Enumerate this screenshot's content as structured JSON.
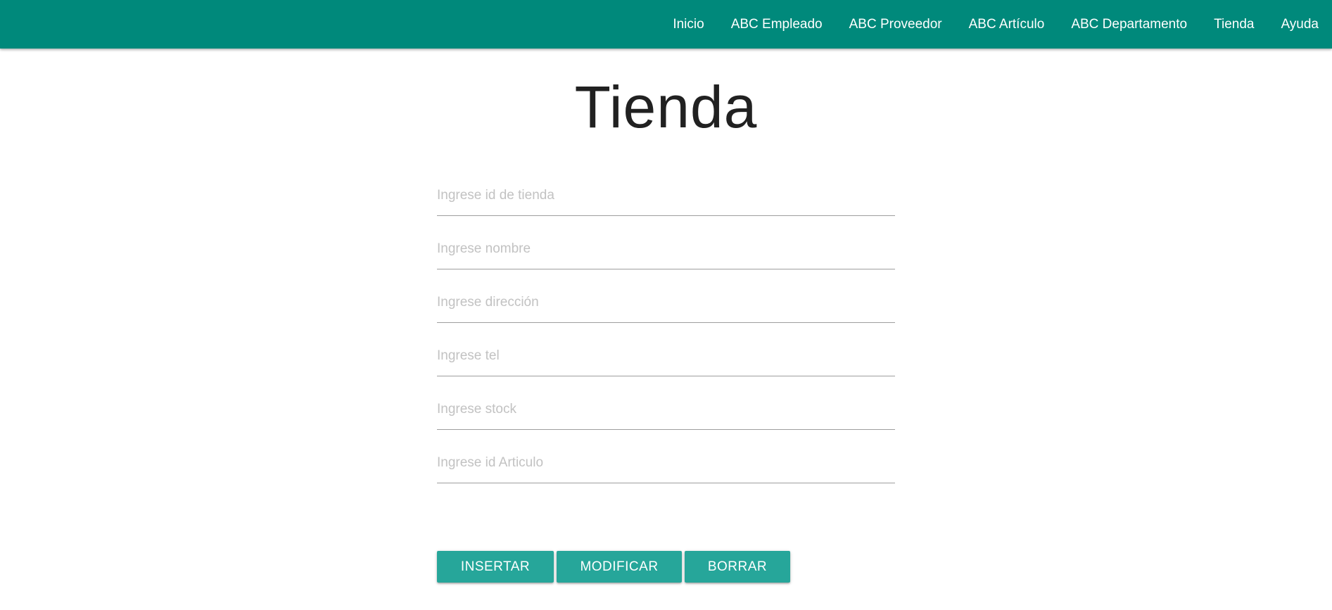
{
  "colors": {
    "navbar": "#00897b",
    "button": "#26a69a",
    "nav_text": "#ffffff",
    "placeholder": "#c2c2c2"
  },
  "nav": {
    "items": [
      {
        "label": "Inicio"
      },
      {
        "label": "ABC Empleado"
      },
      {
        "label": "ABC Proveedor"
      },
      {
        "label": "ABC Artículo"
      },
      {
        "label": "ABC Departamento"
      },
      {
        "label": "Tienda"
      },
      {
        "label": "Ayuda"
      }
    ]
  },
  "page": {
    "title": "Tienda"
  },
  "form": {
    "fields": [
      {
        "placeholder": "Ingrese id de tienda",
        "value": ""
      },
      {
        "placeholder": "Ingrese nombre",
        "value": ""
      },
      {
        "placeholder": "Ingrese dirección",
        "value": ""
      },
      {
        "placeholder": "Ingrese tel",
        "value": ""
      },
      {
        "placeholder": "Ingrese stock",
        "value": ""
      },
      {
        "placeholder": "Ingrese id Articulo",
        "value": ""
      }
    ]
  },
  "buttons": {
    "insert_label": "INSERTAR",
    "modify_label": "MODIFICAR",
    "delete_label": "BORRAR"
  }
}
